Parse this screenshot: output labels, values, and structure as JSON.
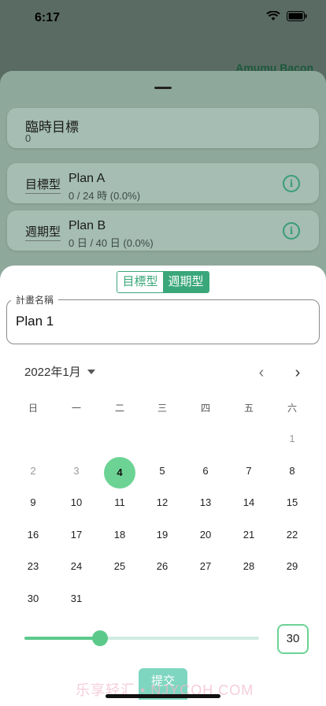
{
  "status": {
    "time": "6:17"
  },
  "background": {
    "user_name": "Amumu Bacon"
  },
  "cards": [
    {
      "title": "臨時目標",
      "sub": "0"
    },
    {
      "type": "目標型",
      "name": "Plan A",
      "progress": "0 /  24 時  (0.0%)"
    },
    {
      "type": "週期型",
      "name": "Plan B",
      "progress": "0 日 / 40 日 (0.0%)"
    }
  ],
  "segment": {
    "option_goal": "目標型",
    "option_cycle": "週期型",
    "selected": "週期型"
  },
  "plan_field": {
    "label": "計畫名稱",
    "value": "Plan 1"
  },
  "calendar": {
    "month_label": "2022年1月",
    "weekdays": [
      "日",
      "一",
      "二",
      "三",
      "四",
      "五",
      "六"
    ],
    "rows": [
      [
        null,
        null,
        null,
        null,
        null,
        null,
        "1"
      ],
      [
        "2",
        "3",
        "4",
        "5",
        "6",
        "7",
        "8"
      ],
      [
        "9",
        "10",
        "11",
        "12",
        "13",
        "14",
        "15"
      ],
      [
        "16",
        "17",
        "18",
        "19",
        "20",
        "21",
        "22"
      ],
      [
        "23",
        "24",
        "25",
        "26",
        "27",
        "28",
        "29"
      ],
      [
        "30",
        "31",
        null,
        null,
        null,
        null,
        null
      ]
    ],
    "muted_days": [
      "1",
      "2",
      "3"
    ],
    "selected_day": "4"
  },
  "slider": {
    "value": "30",
    "fraction": 0.32
  },
  "submit_label": "提交",
  "watermark": "乐享轻汇 • NJYCOH.COM",
  "colors": {
    "accent": "#3aa77a",
    "selected_day": "#6cd394",
    "submit": "#7fd6c0"
  }
}
